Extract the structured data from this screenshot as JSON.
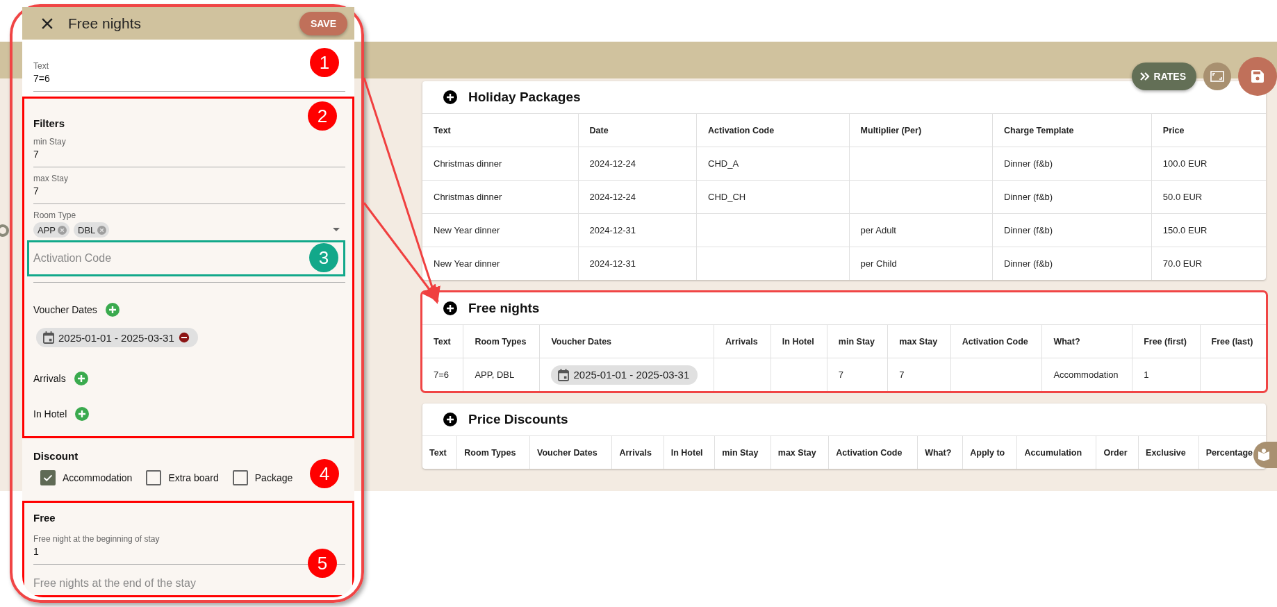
{
  "toolbar": {
    "buttons": [
      {
        "kind": "rates",
        "label": "RATES"
      },
      {
        "kind": "fullscreen"
      },
      {
        "kind": "save"
      }
    ]
  },
  "tables": [
    {
      "title": "Holiday Packages",
      "highlighted": false,
      "columns": [
        "Text",
        "Date",
        "Activation Code",
        "Multiplier (Per)",
        "Charge Template",
        "Price"
      ],
      "rows": [
        [
          "Christmas dinner",
          "2024-12-24",
          "CHD_A",
          null,
          "Dinner (f&b)",
          "100.0 EUR"
        ],
        [
          "Christmas dinner",
          "2024-12-24",
          "CHD_CH",
          null,
          "Dinner (f&b)",
          "50.0 EUR"
        ],
        [
          "New Year dinner",
          "2024-12-31",
          null,
          "per Adult",
          "Dinner (f&b)",
          "150.0 EUR"
        ],
        [
          "New Year dinner",
          "2024-12-31",
          null,
          "per Child",
          "Dinner (f&b)",
          "70.0 EUR"
        ]
      ]
    },
    {
      "title": "Free nights",
      "highlighted": true,
      "columns": [
        "Text",
        "Room Types",
        "Voucher Dates",
        "Arrivals",
        "In Hotel",
        "min Stay",
        "max Stay",
        "Activation Code",
        "What?",
        "Free (first)",
        "Free (last)"
      ],
      "rows": [
        [
          "7=6",
          "APP, DBL",
          {
            "chip": "2025-01-01 - 2025-03-31"
          },
          null,
          null,
          "7",
          "7",
          null,
          "Accommodation",
          "1",
          null
        ]
      ]
    },
    {
      "title": "Price Discounts",
      "highlighted": false,
      "columns": [
        "Text",
        "Room Types",
        "Voucher Dates",
        "Arrivals",
        "In Hotel",
        "min Stay",
        "max Stay",
        "Activation Code",
        "What?",
        "Apply to",
        "Accumulation",
        "Order",
        "Exclusive",
        "Percentage"
      ]
    }
  ],
  "panel": {
    "title": "Free nights",
    "save_label": "SAVE",
    "text_field": {
      "label": "Text",
      "value": "7=6"
    },
    "filters": {
      "heading": "Filters",
      "fields": [
        {
          "label": "min Stay",
          "value": "7"
        },
        {
          "label": "max Stay",
          "value": "7"
        }
      ],
      "room_type": {
        "label": "Room Type",
        "chips": [
          "APP",
          "DBL"
        ]
      },
      "activation_code": {
        "placeholder": "Activation Code"
      },
      "lists": [
        {
          "label": "Voucher Dates",
          "chips": [
            "2025-01-01 - 2025-03-31"
          ]
        },
        {
          "label": "Arrivals"
        },
        {
          "label": "In Hotel"
        }
      ]
    },
    "discount": {
      "heading": "Discount",
      "options": [
        {
          "label": "Accommodation",
          "checked": true
        },
        {
          "label": "Extra board",
          "checked": false
        },
        {
          "label": "Package",
          "checked": false
        }
      ]
    },
    "free": {
      "heading": "Free",
      "field": {
        "label": "Free night at the beginning of stay",
        "value": "1"
      },
      "end_field": {
        "placeholder": "Free nights at the end of the stay"
      }
    }
  },
  "callouts": [
    {
      "label": "1",
      "color": "#ff0000"
    },
    {
      "label": "2",
      "color": "#ff0000"
    },
    {
      "label": "3",
      "color": "#12a88a"
    },
    {
      "label": "4",
      "color": "#ff0000"
    },
    {
      "label": "5",
      "color": "#ff0000"
    }
  ]
}
